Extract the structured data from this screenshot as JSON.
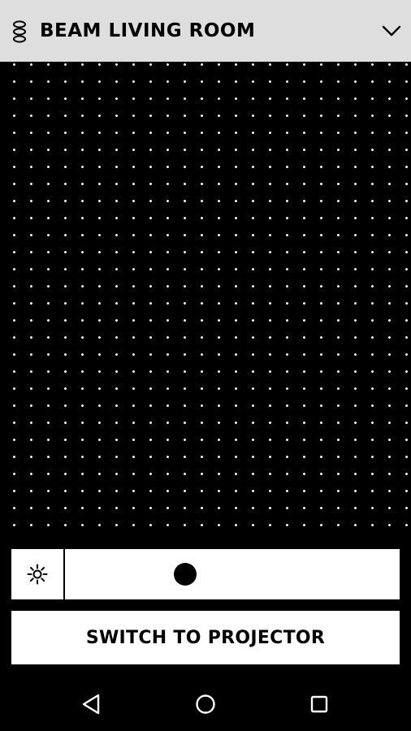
{
  "header": {
    "title": "BEAM LIVING ROOM",
    "logo_icon": "speaker-logo-icon",
    "dropdown_icon": "chevron-down-icon"
  },
  "touchpad": {
    "dot_color": "#ffffff",
    "background_color": "#000000"
  },
  "brightness": {
    "icon": "sun-icon",
    "level": 0.36
  },
  "switch_button": {
    "label": "SWITCH TO PROJECTOR"
  },
  "navbar": {
    "back_icon": "back-triangle-icon",
    "home_icon": "home-circle-icon",
    "recents_icon": "recents-square-icon"
  },
  "colors": {
    "header_bg": "#dedede",
    "page_bg": "#000000",
    "panel_bg": "#ffffff"
  }
}
